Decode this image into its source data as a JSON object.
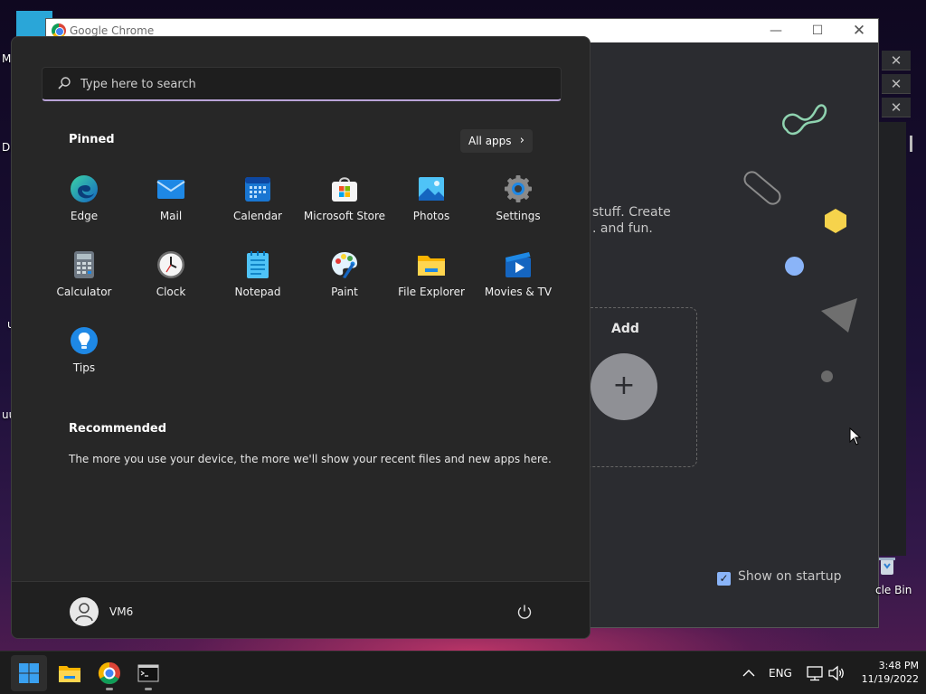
{
  "desktop": {
    "labels": [
      "M",
      "Da",
      "u",
      "uu"
    ],
    "recycle_bin_label": "cle Bin"
  },
  "chrome": {
    "window_title": "Google Chrome",
    "background_text_line1": "stuff. Create",
    "background_text_line2": ". and fun.",
    "add_label": "Add",
    "add_symbol": "+",
    "show_on_startup_label": "Show on startup",
    "show_on_startup_checked": true
  },
  "start_menu": {
    "search": {
      "placeholder": "Type here to search",
      "value": ""
    },
    "pinned_title": "Pinned",
    "all_apps_label": "All apps",
    "pinned_apps": [
      {
        "label": "Edge",
        "icon": "edge-icon"
      },
      {
        "label": "Mail",
        "icon": "mail-icon"
      },
      {
        "label": "Calendar",
        "icon": "calendar-icon"
      },
      {
        "label": "Microsoft Store",
        "icon": "store-icon"
      },
      {
        "label": "Photos",
        "icon": "photos-icon"
      },
      {
        "label": "Settings",
        "icon": "settings-icon"
      },
      {
        "label": "Calculator",
        "icon": "calculator-icon"
      },
      {
        "label": "Clock",
        "icon": "clock-icon"
      },
      {
        "label": "Notepad",
        "icon": "notepad-icon"
      },
      {
        "label": "Paint",
        "icon": "paint-icon"
      },
      {
        "label": "File Explorer",
        "icon": "folder-icon"
      },
      {
        "label": "Movies & TV",
        "icon": "movies-icon"
      },
      {
        "label": "Tips",
        "icon": "tips-icon"
      }
    ],
    "recommended_title": "Recommended",
    "recommended_text": "The more you use your device, the more we'll show your recent files and new apps here.",
    "user_name": "VM6"
  },
  "taskbar": {
    "language": "ENG",
    "time": "3:48 PM",
    "date": "11/19/2022"
  },
  "colors": {
    "accent": "#0078d4",
    "menu_bg": "#272727",
    "search_underline": "#b9a3d8"
  }
}
